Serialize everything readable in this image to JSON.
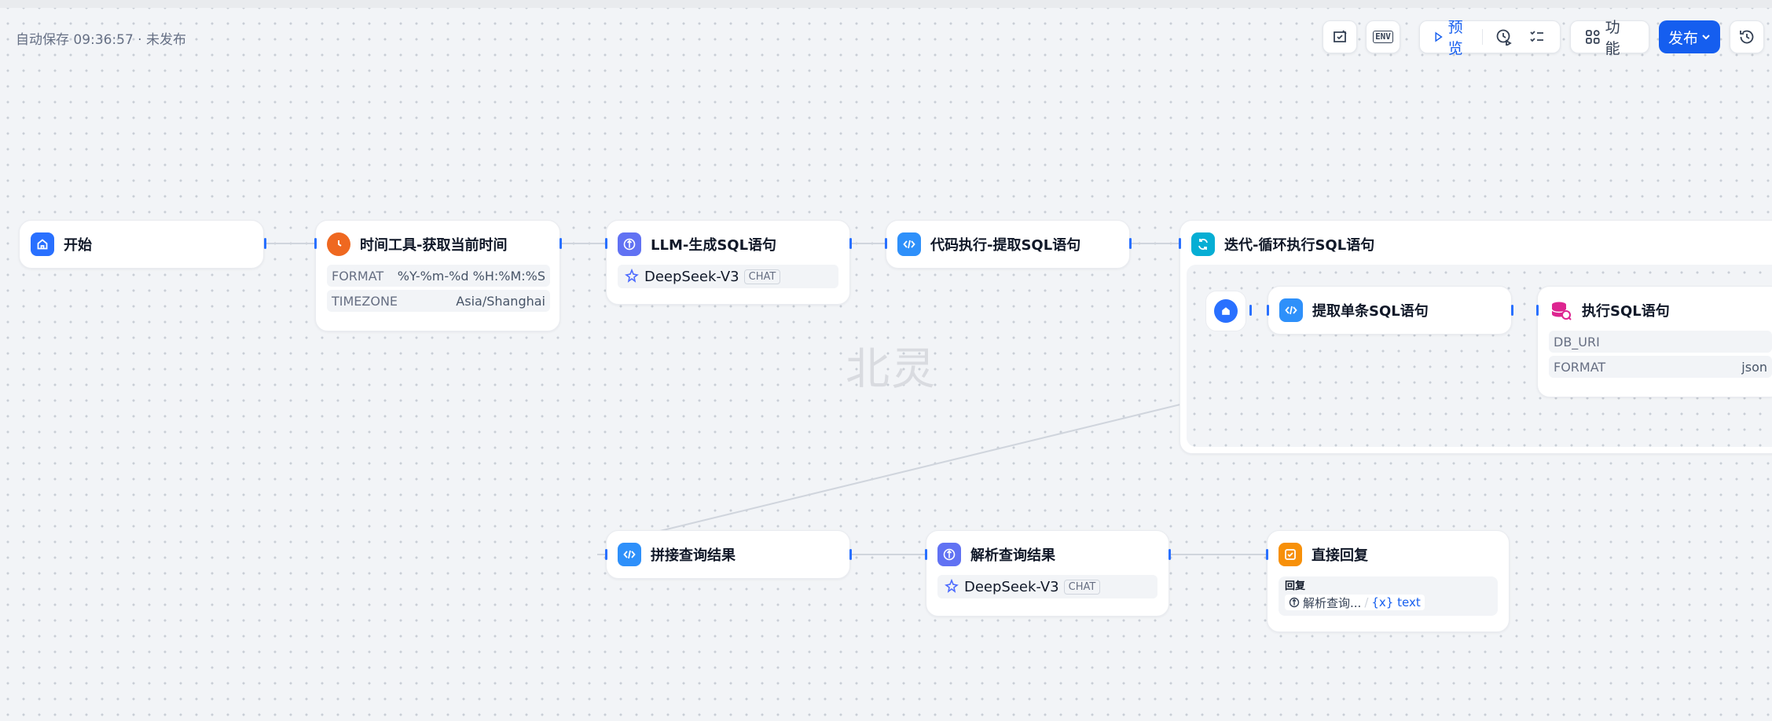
{
  "header": {
    "autosave": "自动保存 09:36:57 · 未发布",
    "env_label": "ENV",
    "preview_label": "预览",
    "features_label": "功能",
    "publish_label": "发布"
  },
  "watermark": "北灵",
  "nodes": {
    "start": {
      "title": "开始"
    },
    "time_tool": {
      "title": "时间工具-获取当前时间",
      "params": [
        {
          "key": "FORMAT",
          "value": "%Y-%m-%d %H:%M:%S"
        },
        {
          "key": "TIMEZONE",
          "value": "Asia/Shanghai"
        }
      ]
    },
    "llm_sql": {
      "title": "LLM-生成SQL语句",
      "model": "DeepSeek-V3",
      "mode": "CHAT"
    },
    "code_extract": {
      "title": "代码执行-提取SQL语句"
    },
    "iteration": {
      "title": "迭代-循环执行SQL语句",
      "children": {
        "extract_single": {
          "title": "提取单条SQL语句"
        },
        "exec_sql": {
          "title": "执行SQL语句",
          "params": [
            {
              "key": "DB_URI",
              "value": ""
            },
            {
              "key": "FORMAT",
              "value": "json"
            }
          ]
        }
      }
    },
    "concat": {
      "title": "拼接查询结果"
    },
    "parse": {
      "title": "解析查询结果",
      "model": "DeepSeek-V3",
      "mode": "CHAT"
    },
    "reply": {
      "title": "直接回复",
      "label": "回复",
      "source": "解析查询...",
      "var": "{x} text"
    }
  },
  "colors": {
    "accent": "#155eef",
    "start_icon": "#2970ff",
    "time_icon": "#ef6820",
    "llm_icon": "#6172f3",
    "code_icon": "#2e90fa",
    "iteration_icon": "#06aed4",
    "db_icon": "#dd2590",
    "reply_icon": "#f79009"
  }
}
